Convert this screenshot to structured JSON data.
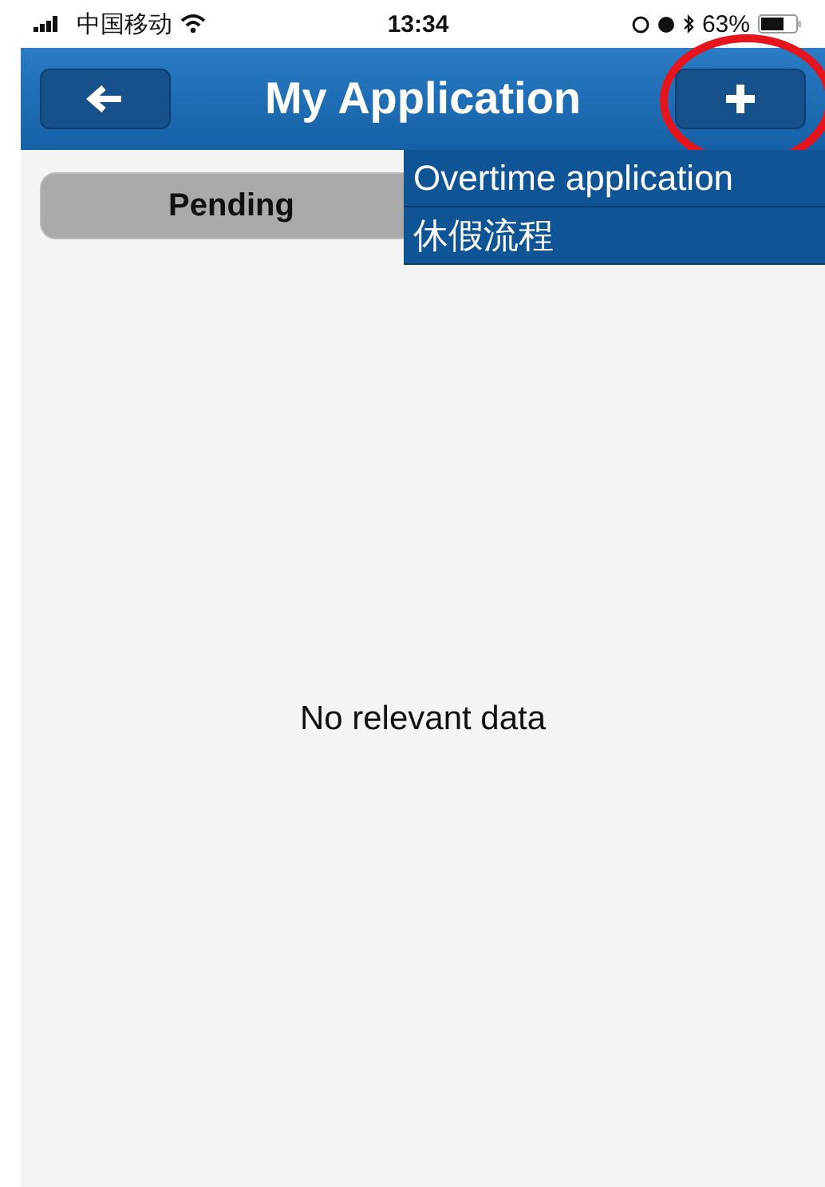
{
  "status_bar": {
    "carrier": "中国移动",
    "time": "13:34",
    "battery": "63%"
  },
  "nav_bar": {
    "title": "My Application",
    "add_highlighted": true
  },
  "tabs": [
    {
      "label": "Pending",
      "selected": true
    }
  ],
  "menu": {
    "items": [
      {
        "label": "Overtime application"
      },
      {
        "label": "休假流程"
      }
    ]
  },
  "empty_message": "No relevant data"
}
